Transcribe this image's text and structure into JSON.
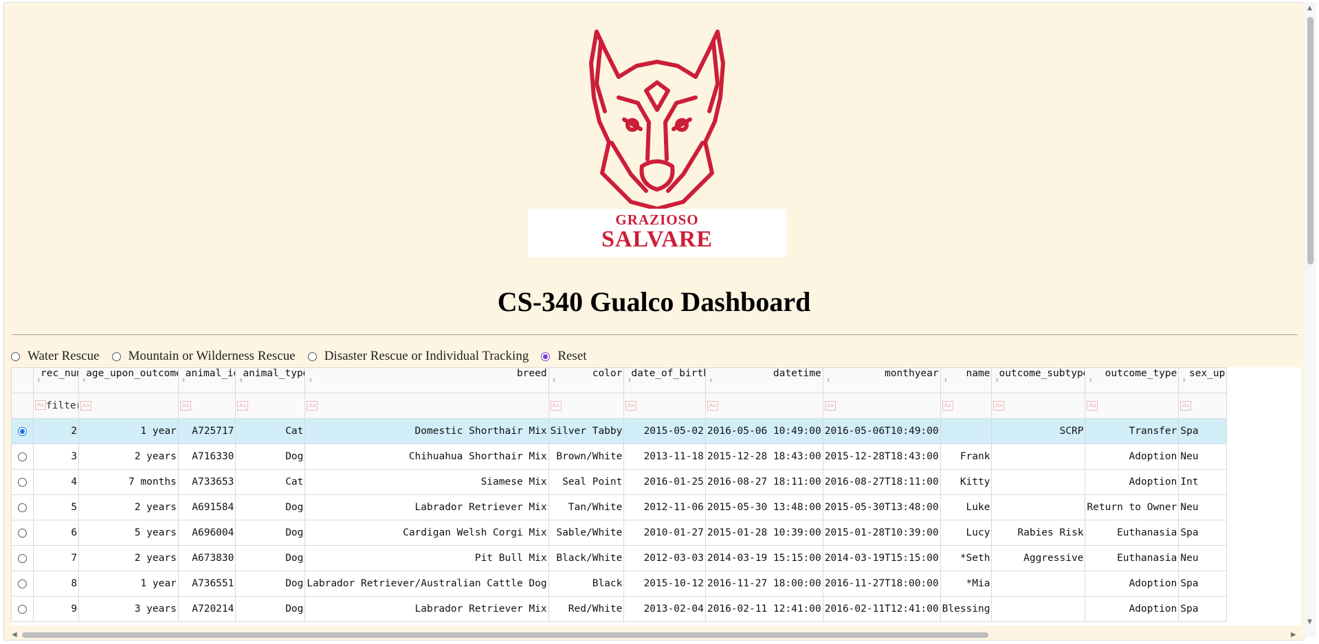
{
  "logo": {
    "line1": "GRAZIOSO",
    "line2": "SALVARE",
    "brand_color": "#cc1e39",
    "icon": "dog-head-icon"
  },
  "title": "CS-340 Gualco Dashboard",
  "filters": {
    "options": [
      {
        "label": "Water Rescue",
        "selected": false
      },
      {
        "label": "Mountain or Wilderness Rescue",
        "selected": false
      },
      {
        "label": "Disaster Rescue or Individual Tracking",
        "selected": false
      },
      {
        "label": "Reset",
        "selected": true
      }
    ]
  },
  "table": {
    "columns": [
      "rec_num",
      "age_upon_outcome",
      "animal_id",
      "animal_type",
      "breed",
      "color",
      "date_of_birth",
      "datetime",
      "monthyear",
      "name",
      "outcome_subtype",
      "outcome_type",
      "sex_up"
    ],
    "filter_placeholder": "filter",
    "rows": [
      {
        "selected": true,
        "cells": [
          "2",
          "1 year",
          "A725717",
          "Cat",
          "Domestic Shorthair Mix",
          "Silver Tabby",
          "2015-05-02",
          "2016-05-06 10:49:00",
          "2016-05-06T10:49:00",
          "",
          "SCRP",
          "Transfer",
          "Spa"
        ]
      },
      {
        "selected": false,
        "cells": [
          "3",
          "2 years",
          "A716330",
          "Dog",
          "Chihuahua Shorthair Mix",
          "Brown/White",
          "2013-11-18",
          "2015-12-28 18:43:00",
          "2015-12-28T18:43:00",
          "Frank",
          "",
          "Adoption",
          "Neu"
        ]
      },
      {
        "selected": false,
        "cells": [
          "4",
          "7 months",
          "A733653",
          "Cat",
          "Siamese Mix",
          "Seal Point",
          "2016-01-25",
          "2016-08-27 18:11:00",
          "2016-08-27T18:11:00",
          "Kitty",
          "",
          "Adoption",
          "Int"
        ]
      },
      {
        "selected": false,
        "cells": [
          "5",
          "2 years",
          "A691584",
          "Dog",
          "Labrador Retriever Mix",
          "Tan/White",
          "2012-11-06",
          "2015-05-30 13:48:00",
          "2015-05-30T13:48:00",
          "Luke",
          "",
          "Return to Owner",
          "Neu"
        ]
      },
      {
        "selected": false,
        "cells": [
          "6",
          "5 years",
          "A696004",
          "Dog",
          "Cardigan Welsh Corgi Mix",
          "Sable/White",
          "2010-01-27",
          "2015-01-28 10:39:00",
          "2015-01-28T10:39:00",
          "Lucy",
          "Rabies Risk",
          "Euthanasia",
          "Spa"
        ]
      },
      {
        "selected": false,
        "cells": [
          "7",
          "2 years",
          "A673830",
          "Dog",
          "Pit Bull Mix",
          "Black/White",
          "2012-03-03",
          "2014-03-19 15:15:00",
          "2014-03-19T15:15:00",
          "*Seth",
          "Aggressive",
          "Euthanasia",
          "Neu"
        ]
      },
      {
        "selected": false,
        "cells": [
          "8",
          "1 year",
          "A736551",
          "Dog",
          "Labrador Retriever/Australian Cattle Dog",
          "Black",
          "2015-10-12",
          "2016-11-27 18:00:00",
          "2016-11-27T18:00:00",
          "*Mia",
          "",
          "Adoption",
          "Spa"
        ]
      },
      {
        "selected": false,
        "cells": [
          "9",
          "3 years",
          "A720214",
          "Dog",
          "Labrador Retriever Mix",
          "Red/White",
          "2013-02-04",
          "2016-02-11 12:41:00",
          "2016-02-11T12:41:00",
          "Blessing",
          "",
          "Adoption",
          "Spa"
        ]
      }
    ]
  },
  "colors": {
    "page_bg": "#fdf5e2",
    "selected_row": "#d2eef8",
    "radio_accent": "#7b3fcf"
  }
}
